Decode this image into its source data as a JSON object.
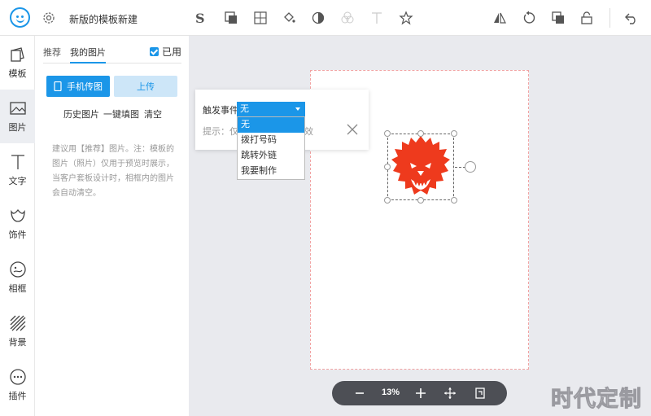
{
  "header": {
    "title": "新版的模板新建"
  },
  "rail": {
    "items": [
      {
        "label": "模板",
        "icon": "template-icon"
      },
      {
        "label": "图片",
        "icon": "image-icon"
      },
      {
        "label": "文字",
        "icon": "text-icon"
      },
      {
        "label": "饰件",
        "icon": "ornament-icon"
      },
      {
        "label": "相框",
        "icon": "frame-icon"
      },
      {
        "label": "背景",
        "icon": "background-icon"
      },
      {
        "label": "插件",
        "icon": "plugin-icon"
      }
    ]
  },
  "panel": {
    "tabs": [
      "推荐",
      "我的图片"
    ],
    "used_label": "已用",
    "phone_upload": "手机传图",
    "upload": "上传",
    "links": [
      "历史图片",
      "一键填图",
      "清空"
    ],
    "hint": "建议用【推荐】图片。注：模板的图片（照片）仅用于预览时展示，当客户套板设计时，相框内的图片会自动清空。"
  },
  "popup": {
    "label": "触发事件",
    "tip": "提示：仅",
    "tip_tail": "效",
    "selected": "无",
    "options": [
      "无",
      "拨打号码",
      "跳转外链",
      "我要制作"
    ]
  },
  "zoom": {
    "value": "13%"
  },
  "watermark": "时代定制",
  "colors": {
    "accent": "#1b96e8",
    "lion": "#ee3a1d"
  }
}
